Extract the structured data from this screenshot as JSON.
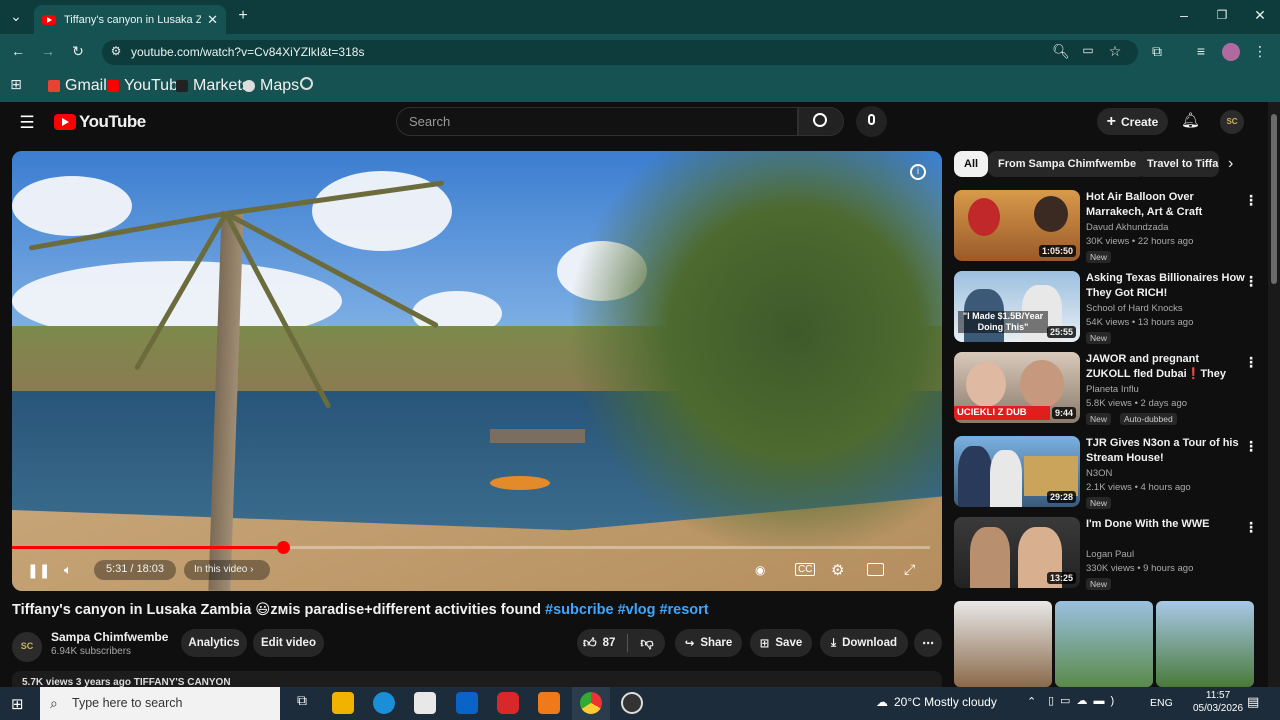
{
  "browser": {
    "tab_title": "Tiffany's canyon in Lusaka Zamb",
    "url": "youtube.com/watch?v=Cv84XiYZlkI&t=318s",
    "bookmarks": [
      "Gmail",
      "YouTube",
      "Markets",
      "Maps"
    ]
  },
  "youtube": {
    "logo": "YouTube",
    "search_placeholder": "Search",
    "create_label": "Create",
    "avatar_initials": "SC"
  },
  "player": {
    "progress": 0.295,
    "time": "5:31 / 18:03",
    "chapter": "In this video"
  },
  "video": {
    "title": "Tiffany's canyon in Lusaka Zambia 😃ᴢᴍis paradise+different activities found",
    "hashtags": "#subcribe #vlog #resort",
    "channel": "Sampa Chimfwembe",
    "subscribers": "6.94K subscribers",
    "analytics_label": "Analytics",
    "edit_label": "Edit video",
    "likes": "87",
    "share_label": "Share",
    "save_label": "Save",
    "download_label": "Download",
    "description_line": "5.7K views  3 years ago  TIFFANY'S CANYON"
  },
  "chips": [
    "All",
    "From Sampa Chimfwembe",
    "Travel to Tiffa"
  ],
  "recommendations": [
    {
      "title": "Hot Air Balloon Over Marrakech, Art & Craft Shopping in Old ...",
      "channel": "Davud Akhundzada",
      "meta": "30K views • 22 hours ago",
      "badge": "New",
      "duration": "1:05:50"
    },
    {
      "title": "Asking Texas Billionaires How They Got RICH!",
      "channel": "School of Hard Knocks",
      "meta": "54K views • 13 hours ago",
      "badge": "New",
      "duration": "25:55"
    },
    {
      "title": "JAWOR and pregnant ZUKOLL fled Dubai❗They paid the ...",
      "channel": "Planeta Influ",
      "meta": "5.8K views • 2 days ago",
      "badge": "New",
      "badge2": "Auto-dubbed",
      "duration": "9:44"
    },
    {
      "title": "TJR Gives N3on a Tour of his Stream House!",
      "channel": "N3ON",
      "meta": "2.1K views • 4 hours ago",
      "badge": "New",
      "duration": "29:28"
    },
    {
      "title": "I'm Done With the WWE",
      "channel": "Logan Paul",
      "meta": "330K views • 9 hours ago",
      "badge": "New",
      "duration": "13:25"
    }
  ],
  "thumb_text": [
    "\"I Made $1.5B/Year Doing This\"",
    "UCIEKLI Z DUB"
  ],
  "taskbar": {
    "search_placeholder": "Type here to search",
    "weather": "20°C  Mostly cloudy",
    "lang": "ENG",
    "time": "11:57",
    "date": "05/03/2026"
  },
  "colors": {
    "accent": "#ff0000",
    "link": "#3ea6ff",
    "chrome": "#165252"
  }
}
